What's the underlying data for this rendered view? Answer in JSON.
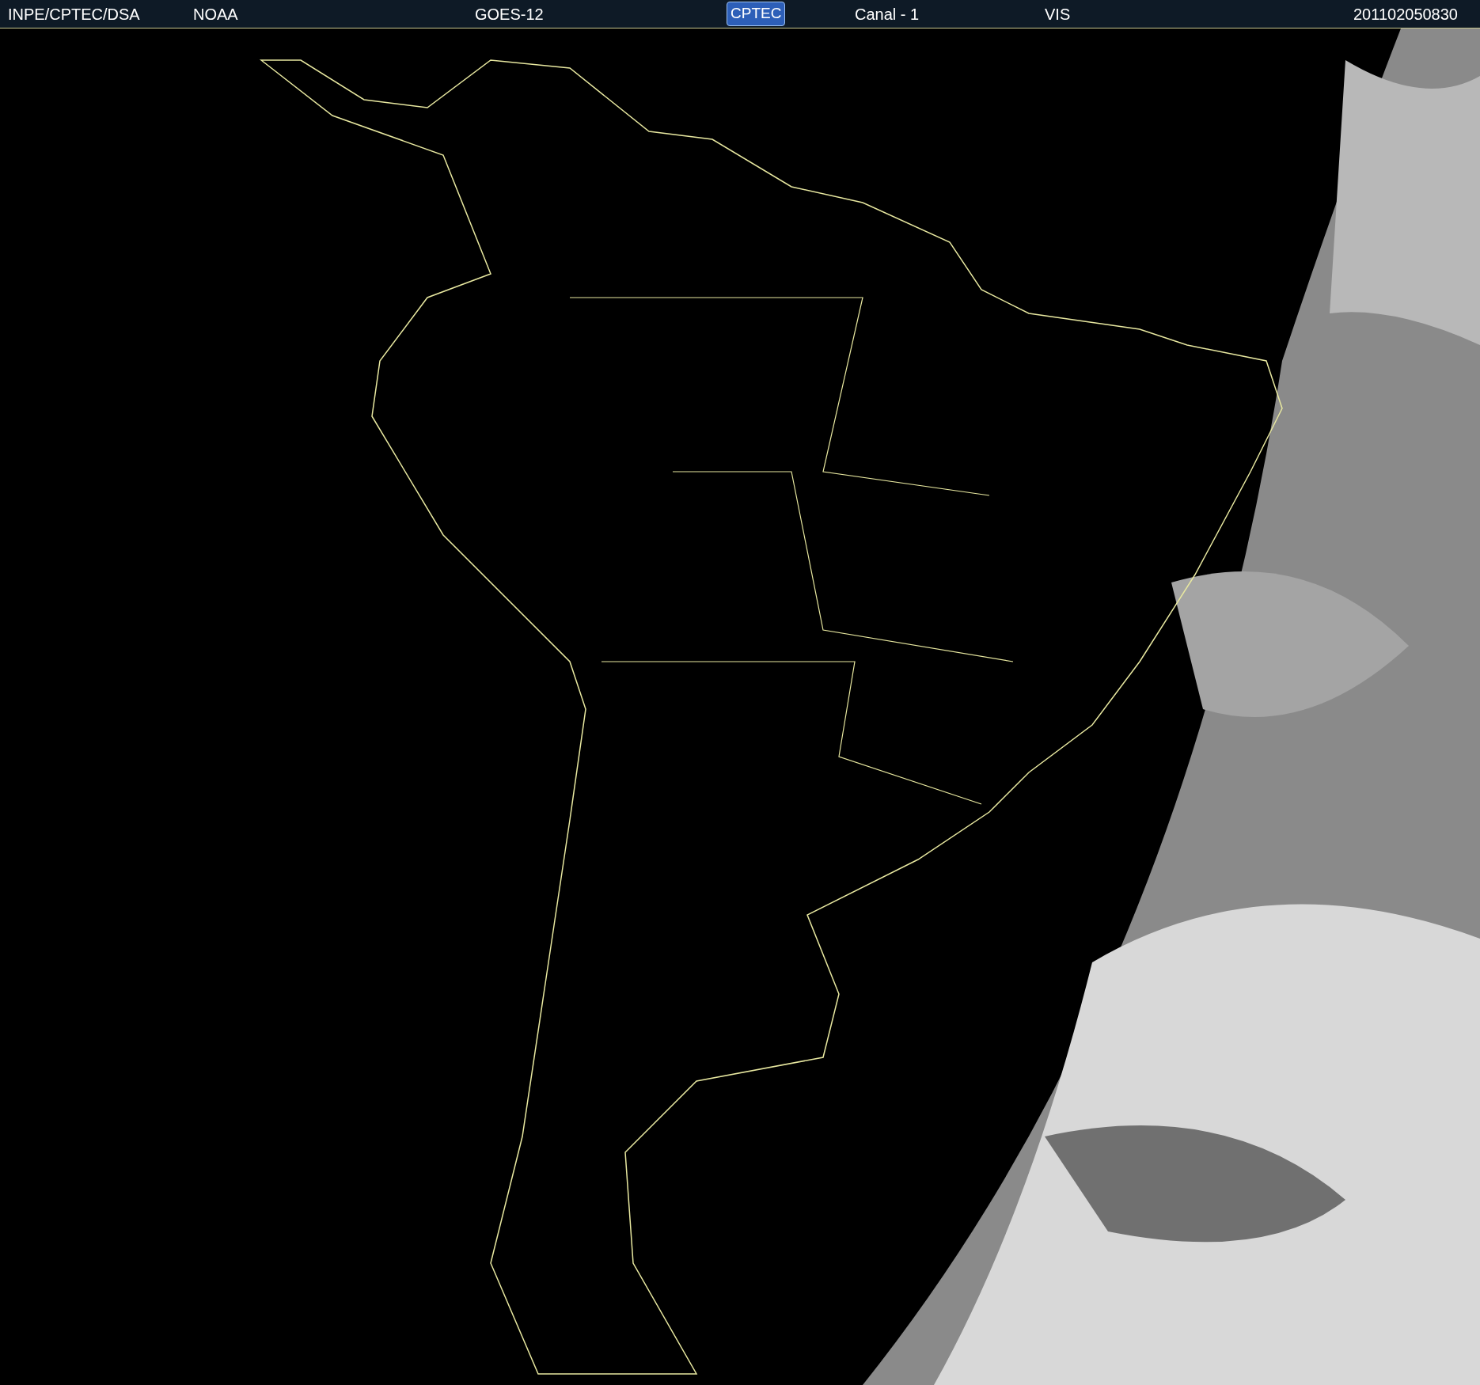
{
  "header": {
    "source": "INPE/CPTEC/DSA",
    "agency": "NOAA",
    "satellite": "GOES-12",
    "logo": "CPTEC",
    "channel": "Canal - 1",
    "band": "VIS",
    "timestamp": "201102050830"
  }
}
